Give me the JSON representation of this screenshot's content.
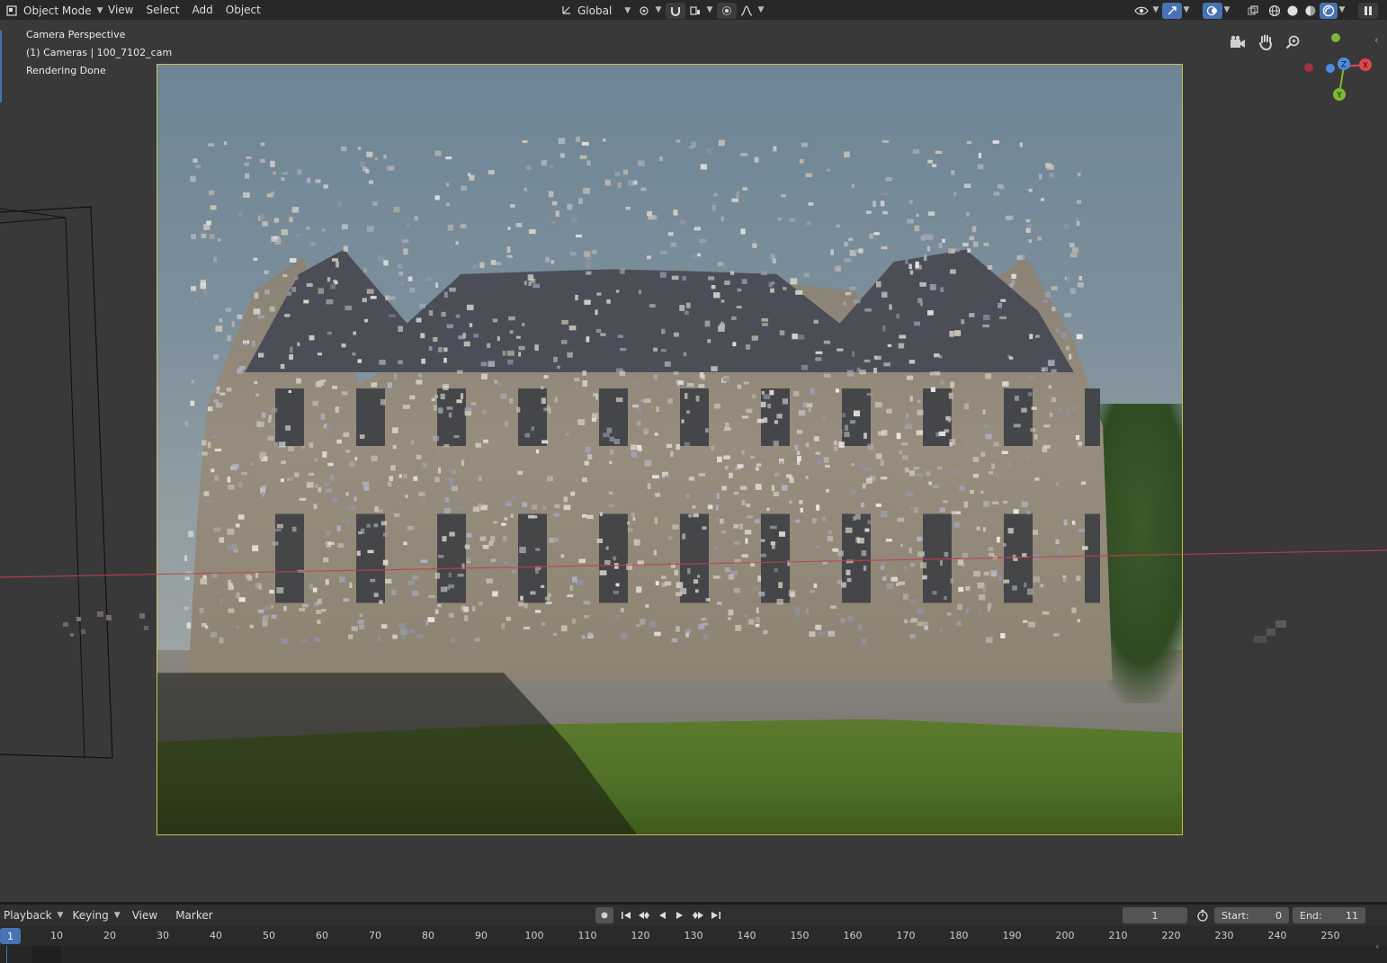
{
  "header": {
    "mode_label": "Object Mode",
    "menus": [
      "View",
      "Select",
      "Add",
      "Object"
    ],
    "orientation_label": "Global"
  },
  "viewport": {
    "overlay_lines": [
      "Camera Perspective",
      "(1) Cameras | 100_7102_cam",
      "Rendering Done"
    ],
    "gizmo": {
      "x_label": "X",
      "y_label": "Y",
      "z_label": "Z"
    }
  },
  "timeline": {
    "menus": [
      "Playback",
      "Keying",
      "View",
      "Marker"
    ],
    "current_frame": "1",
    "start_label": "Start:",
    "start_value": "0",
    "end_label": "End:",
    "end_value": "11",
    "ruler_current": "1",
    "ruler_ticks": [
      "10",
      "20",
      "30",
      "40",
      "50",
      "60",
      "70",
      "80",
      "90",
      "100",
      "110",
      "120",
      "130",
      "140",
      "150",
      "160",
      "170",
      "180",
      "190",
      "200",
      "210",
      "220",
      "230",
      "240",
      "250"
    ]
  },
  "colors": {
    "accent": "#4772b3",
    "x_axis": "#e5454f",
    "y_axis": "#7fb733",
    "z_axis": "#4a8ee0",
    "camera_frame": "#c8c04a"
  },
  "icons": {
    "editor_type": "3d-viewport-icon",
    "transform_orientation": "orientation-icon",
    "pivot": "pivot-point-icon",
    "snap": "magnet-icon",
    "proportional": "proportional-edit-icon",
    "visibility": "eye-icon",
    "gizmo_toggle": "gizmo-icon",
    "overlay_toggle": "overlay-icon",
    "xray": "xray-icon",
    "shading": [
      "wireframe-icon",
      "solid-icon",
      "material-icon",
      "rendered-icon"
    ],
    "camera_view": "camera-icon",
    "pan": "hand-icon",
    "zoom": "zoom-icon",
    "record": "record-icon",
    "playback": [
      "jump-start-icon",
      "prev-keyframe-icon",
      "play-reverse-icon",
      "play-icon",
      "next-keyframe-icon",
      "jump-end-icon"
    ],
    "stopwatch": "stopwatch-icon"
  }
}
